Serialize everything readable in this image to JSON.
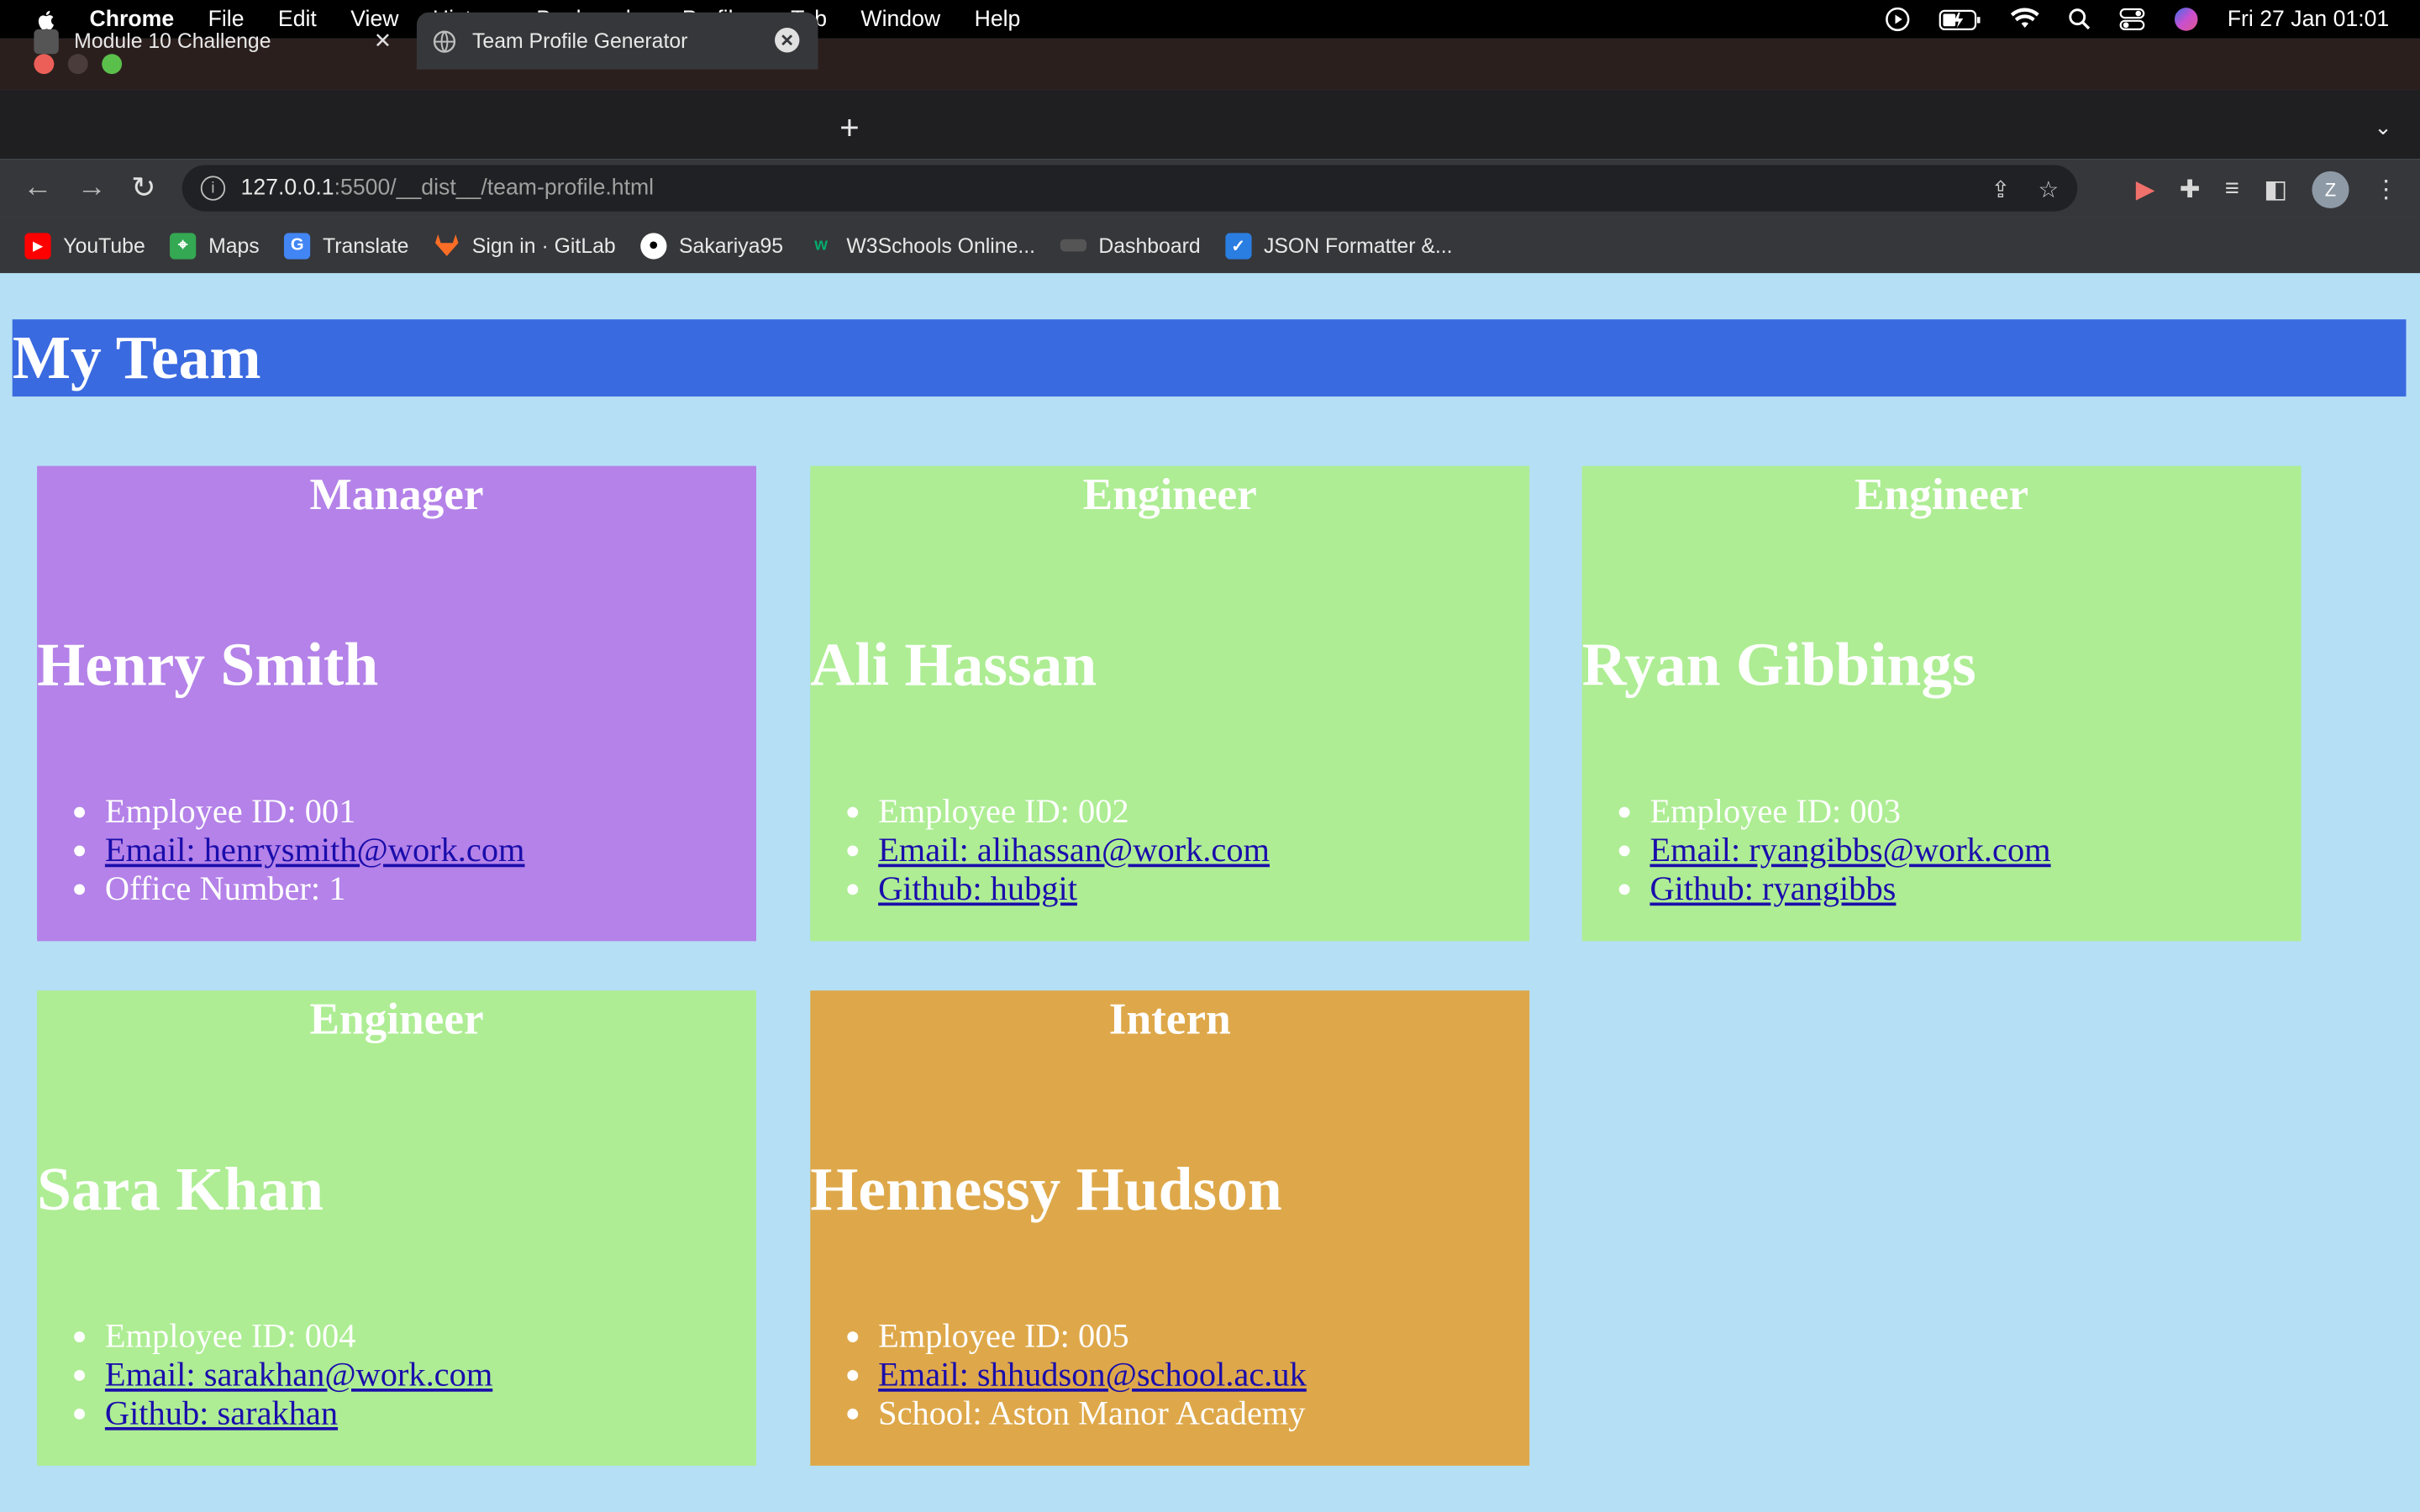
{
  "menubar": {
    "app": "Chrome",
    "items": [
      "File",
      "Edit",
      "View",
      "History",
      "Bookmarks",
      "Profiles",
      "Tab",
      "Window",
      "Help"
    ],
    "clock": "Fri 27 Jan  01:01"
  },
  "tabs": [
    {
      "title": "Module 10 Challenge",
      "active": false
    },
    {
      "title": "Team Profile Generator",
      "active": true
    }
  ],
  "omnibox": {
    "host": "127.0.0.1",
    "path": ":5500/__dist__/team-profile.html"
  },
  "bookmarks": [
    {
      "label": "YouTube",
      "icon": "youtube-icon",
      "color": "#ff0000"
    },
    {
      "label": "Maps",
      "icon": "maps-icon",
      "color": "#34a853"
    },
    {
      "label": "Translate",
      "icon": "translate-icon",
      "color": "#4285f4"
    },
    {
      "label": "Sign in · GitLab",
      "icon": "gitlab-icon",
      "color": "#fc6d26"
    },
    {
      "label": "Sakariya95",
      "icon": "github-icon",
      "color": "#ffffff"
    },
    {
      "label": "W3Schools Online...",
      "icon": "w3schools-icon",
      "color": "#04aa6d"
    },
    {
      "label": "Dashboard",
      "icon": "dashboard-icon",
      "color": "#555555"
    },
    {
      "label": "JSON Formatter &...",
      "icon": "json-icon",
      "color": "#2a7de1"
    }
  ],
  "avatar_letter": "Z",
  "page": {
    "title": "My Team",
    "cards": [
      {
        "role": "Manager",
        "name": "Henry Smith",
        "id": "Employee ID: 001",
        "email": "Email: henrysmith@work.com",
        "extra": "Office Number: 1",
        "extra_link": false,
        "color": "#b482e8"
      },
      {
        "role": "Engineer",
        "name": "Ali Hassan",
        "id": "Employee ID: 002",
        "email": "Email: alihassan@work.com",
        "extra": "Github: hubgit",
        "extra_link": true,
        "color": "#aeed94"
      },
      {
        "role": "Engineer",
        "name": "Ryan Gibbings",
        "id": "Employee ID: 003",
        "email": "Email: ryangibbs@work.com",
        "extra": "Github: ryangibbs",
        "extra_link": true,
        "color": "#aeed94"
      },
      {
        "role": "Engineer",
        "name": "Sara Khan",
        "id": "Employee ID: 004",
        "email": "Email: sarakhan@work.com",
        "extra": "Github: sarakhan",
        "extra_link": true,
        "color": "#aeed94"
      },
      {
        "role": "Intern",
        "name": "Hennessy Hudson",
        "id": "Employee ID: 005",
        "email": "Email: shhudson@school.ac.uk",
        "extra": "School: Aston Manor Academy",
        "extra_link": false,
        "color": "#dea84a"
      }
    ]
  }
}
